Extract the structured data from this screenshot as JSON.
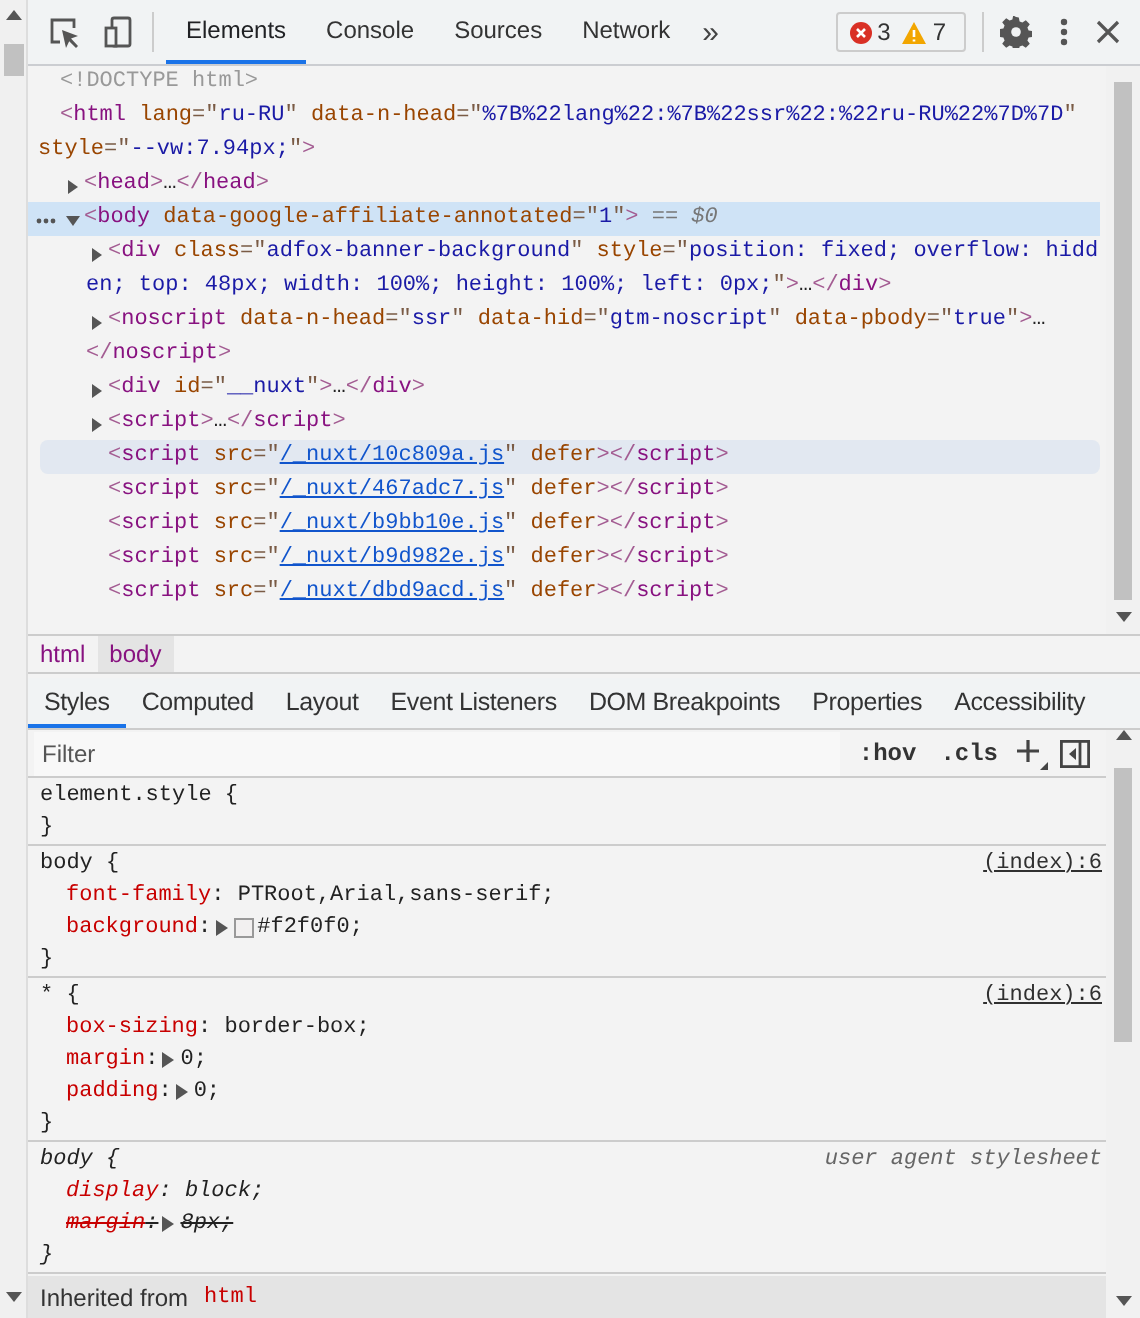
{
  "toolbar": {
    "tabs": [
      {
        "label": "Elements",
        "selected": true
      },
      {
        "label": "Console",
        "selected": false
      },
      {
        "label": "Sources",
        "selected": false
      },
      {
        "label": "Network",
        "selected": false
      }
    ],
    "more": "»",
    "issues": {
      "errors": "3",
      "warnings": "7"
    }
  },
  "dom_tree": [
    {
      "selected": false,
      "hovered": false,
      "lines": [
        [
          {
            "kind": "doctype",
            "text": "<!DOCTYPE html>"
          }
        ]
      ]
    },
    {
      "selected": false,
      "hovered": false,
      "lines": [
        [
          {
            "kind": "bracket",
            "text": "<"
          },
          {
            "kind": "tag",
            "text": "html"
          },
          {
            "kind": "attr",
            "text": " lang"
          },
          {
            "kind": "quote",
            "text": "=\""
          },
          {
            "kind": "value",
            "text": "ru-RU"
          },
          {
            "kind": "quote",
            "text": "\""
          },
          {
            "kind": "attr",
            "text": " data-n-head"
          },
          {
            "kind": "quote",
            "text": "=\""
          },
          {
            "kind": "value",
            "text": "%7B%22lang%22:%7B%22ssr%22:%22ru-RU%22%7D%7D"
          },
          {
            "kind": "quote",
            "text": "\""
          }
        ],
        [
          {
            "kind": "attr",
            "text": "style"
          },
          {
            "kind": "quote",
            "text": "=\""
          },
          {
            "kind": "value",
            "text": "--vw:7.94px;"
          },
          {
            "kind": "quote",
            "text": "\""
          },
          {
            "kind": "bracket",
            "text": ">"
          }
        ]
      ],
      "children": [
        {
          "selected": false,
          "hovered": false,
          "expanded": false,
          "lines": [
            [
              {
                "kind": "bracket",
                "text": "<"
              },
              {
                "kind": "tag",
                "text": "head"
              },
              {
                "kind": "bracket",
                "text": ">"
              },
              {
                "kind": "text",
                "text": "…"
              },
              {
                "kind": "bracket",
                "text": "</"
              },
              {
                "kind": "tag",
                "text": "head"
              },
              {
                "kind": "bracket",
                "text": ">"
              }
            ]
          ]
        },
        {
          "selected": true,
          "hovered": false,
          "expanded": true,
          "lines": [
            [
              {
                "kind": "bracket",
                "text": "<"
              },
              {
                "kind": "tag",
                "text": "body"
              },
              {
                "kind": "attr",
                "text": " data-google-affiliate-annotated"
              },
              {
                "kind": "quote",
                "text": "=\""
              },
              {
                "kind": "value",
                "text": "1"
              },
              {
                "kind": "quote",
                "text": "\""
              },
              {
                "kind": "bracket",
                "text": ">"
              },
              {
                "kind": "hint",
                "text": " == $0"
              }
            ]
          ],
          "children": [
            {
              "selected": false,
              "hovered": false,
              "expanded": false,
              "lines": [
                [
                  {
                    "kind": "bracket",
                    "text": "<"
                  },
                  {
                    "kind": "tag",
                    "text": "div"
                  },
                  {
                    "kind": "attr",
                    "text": " class"
                  },
                  {
                    "kind": "quote",
                    "text": "=\""
                  },
                  {
                    "kind": "value",
                    "text": "adfox-banner-background"
                  },
                  {
                    "kind": "quote",
                    "text": "\""
                  },
                  {
                    "kind": "attr",
                    "text": " style"
                  },
                  {
                    "kind": "quote",
                    "text": "=\""
                  },
                  {
                    "kind": "value",
                    "text": "position: fixed; overflow: hidd"
                  }
                ],
                [
                  {
                    "kind": "value",
                    "text": "en; top: 48px; width: 100%; height: 100%; left: 0px;"
                  },
                  {
                    "kind": "quote",
                    "text": "\""
                  },
                  {
                    "kind": "bracket",
                    "text": ">"
                  },
                  {
                    "kind": "text",
                    "text": "…"
                  },
                  {
                    "kind": "bracket",
                    "text": "</"
                  },
                  {
                    "kind": "tag",
                    "text": "div"
                  },
                  {
                    "kind": "bracket",
                    "text": ">"
                  }
                ]
              ]
            },
            {
              "selected": false,
              "hovered": false,
              "expanded": false,
              "lines": [
                [
                  {
                    "kind": "bracket",
                    "text": "<"
                  },
                  {
                    "kind": "tag",
                    "text": "noscript"
                  },
                  {
                    "kind": "attr",
                    "text": " data-n-head"
                  },
                  {
                    "kind": "quote",
                    "text": "=\""
                  },
                  {
                    "kind": "value",
                    "text": "ssr"
                  },
                  {
                    "kind": "quote",
                    "text": "\""
                  },
                  {
                    "kind": "attr",
                    "text": " data-hid"
                  },
                  {
                    "kind": "quote",
                    "text": "=\""
                  },
                  {
                    "kind": "value",
                    "text": "gtm-noscript"
                  },
                  {
                    "kind": "quote",
                    "text": "\""
                  },
                  {
                    "kind": "attr",
                    "text": " data-pbody"
                  },
                  {
                    "kind": "quote",
                    "text": "=\""
                  },
                  {
                    "kind": "value",
                    "text": "true"
                  },
                  {
                    "kind": "quote",
                    "text": "\""
                  },
                  {
                    "kind": "bracket",
                    "text": ">"
                  },
                  {
                    "kind": "text",
                    "text": "…"
                  }
                ],
                [
                  {
                    "kind": "bracket",
                    "text": "</"
                  },
                  {
                    "kind": "tag",
                    "text": "noscript"
                  },
                  {
                    "kind": "bracket",
                    "text": ">"
                  }
                ]
              ]
            },
            {
              "selected": false,
              "hovered": false,
              "expanded": false,
              "lines": [
                [
                  {
                    "kind": "bracket",
                    "text": "<"
                  },
                  {
                    "kind": "tag",
                    "text": "div"
                  },
                  {
                    "kind": "attr",
                    "text": " id"
                  },
                  {
                    "kind": "quote",
                    "text": "=\""
                  },
                  {
                    "kind": "value",
                    "text": "__nuxt"
                  },
                  {
                    "kind": "quote",
                    "text": "\""
                  },
                  {
                    "kind": "bracket",
                    "text": ">"
                  },
                  {
                    "kind": "text",
                    "text": "…"
                  },
                  {
                    "kind": "bracket",
                    "text": "</"
                  },
                  {
                    "kind": "tag",
                    "text": "div"
                  },
                  {
                    "kind": "bracket",
                    "text": ">"
                  }
                ]
              ]
            },
            {
              "selected": false,
              "hovered": false,
              "expanded": false,
              "lines": [
                [
                  {
                    "kind": "bracket",
                    "text": "<"
                  },
                  {
                    "kind": "tag",
                    "text": "script"
                  },
                  {
                    "kind": "bracket",
                    "text": ">"
                  },
                  {
                    "kind": "text",
                    "text": "…"
                  },
                  {
                    "kind": "bracket",
                    "text": "</"
                  },
                  {
                    "kind": "tag",
                    "text": "script"
                  },
                  {
                    "kind": "bracket",
                    "text": ">"
                  }
                ]
              ]
            },
            {
              "selected": false,
              "hovered": true,
              "lines": [
                [
                  {
                    "kind": "bracket",
                    "text": "<"
                  },
                  {
                    "kind": "tag",
                    "text": "script"
                  },
                  {
                    "kind": "attr",
                    "text": " src"
                  },
                  {
                    "kind": "quote",
                    "text": "=\""
                  },
                  {
                    "kind": "link",
                    "text": "/_nuxt/10c809a.js"
                  },
                  {
                    "kind": "quote",
                    "text": "\""
                  },
                  {
                    "kind": "attr",
                    "text": " defer"
                  },
                  {
                    "kind": "bracket",
                    "text": "></"
                  },
                  {
                    "kind": "tag",
                    "text": "script"
                  },
                  {
                    "kind": "bracket",
                    "text": ">"
                  }
                ]
              ]
            },
            {
              "selected": false,
              "hovered": false,
              "lines": [
                [
                  {
                    "kind": "bracket",
                    "text": "<"
                  },
                  {
                    "kind": "tag",
                    "text": "script"
                  },
                  {
                    "kind": "attr",
                    "text": " src"
                  },
                  {
                    "kind": "quote",
                    "text": "=\""
                  },
                  {
                    "kind": "link",
                    "text": "/_nuxt/467adc7.js"
                  },
                  {
                    "kind": "quote",
                    "text": "\""
                  },
                  {
                    "kind": "attr",
                    "text": " defer"
                  },
                  {
                    "kind": "bracket",
                    "text": "></"
                  },
                  {
                    "kind": "tag",
                    "text": "script"
                  },
                  {
                    "kind": "bracket",
                    "text": ">"
                  }
                ]
              ]
            },
            {
              "selected": false,
              "hovered": false,
              "lines": [
                [
                  {
                    "kind": "bracket",
                    "text": "<"
                  },
                  {
                    "kind": "tag",
                    "text": "script"
                  },
                  {
                    "kind": "attr",
                    "text": " src"
                  },
                  {
                    "kind": "quote",
                    "text": "=\""
                  },
                  {
                    "kind": "link",
                    "text": "/_nuxt/b9bb10e.js"
                  },
                  {
                    "kind": "quote",
                    "text": "\""
                  },
                  {
                    "kind": "attr",
                    "text": " defer"
                  },
                  {
                    "kind": "bracket",
                    "text": "></"
                  },
                  {
                    "kind": "tag",
                    "text": "script"
                  },
                  {
                    "kind": "bracket",
                    "text": ">"
                  }
                ]
              ]
            },
            {
              "selected": false,
              "hovered": false,
              "lines": [
                [
                  {
                    "kind": "bracket",
                    "text": "<"
                  },
                  {
                    "kind": "tag",
                    "text": "script"
                  },
                  {
                    "kind": "attr",
                    "text": " src"
                  },
                  {
                    "kind": "quote",
                    "text": "=\""
                  },
                  {
                    "kind": "link",
                    "text": "/_nuxt/b9d982e.js"
                  },
                  {
                    "kind": "quote",
                    "text": "\""
                  },
                  {
                    "kind": "attr",
                    "text": " defer"
                  },
                  {
                    "kind": "bracket",
                    "text": "></"
                  },
                  {
                    "kind": "tag",
                    "text": "script"
                  },
                  {
                    "kind": "bracket",
                    "text": ">"
                  }
                ]
              ]
            },
            {
              "selected": false,
              "hovered": false,
              "lines": [
                [
                  {
                    "kind": "bracket",
                    "text": "<"
                  },
                  {
                    "kind": "tag",
                    "text": "script"
                  },
                  {
                    "kind": "attr",
                    "text": " src"
                  },
                  {
                    "kind": "quote",
                    "text": "=\""
                  },
                  {
                    "kind": "link",
                    "text": "/_nuxt/dbd9acd.js"
                  },
                  {
                    "kind": "quote",
                    "text": "\""
                  },
                  {
                    "kind": "attr",
                    "text": " defer"
                  },
                  {
                    "kind": "bracket",
                    "text": "></"
                  },
                  {
                    "kind": "tag",
                    "text": "script"
                  },
                  {
                    "kind": "bracket",
                    "text": ">"
                  }
                ]
              ]
            }
          ]
        }
      ]
    }
  ],
  "breadcrumbs": [
    {
      "label": "html",
      "selected": false
    },
    {
      "label": "body",
      "selected": true
    }
  ],
  "sidebar_tabs": [
    {
      "label": "Styles",
      "selected": true
    },
    {
      "label": "Computed",
      "selected": false
    },
    {
      "label": "Layout",
      "selected": false
    },
    {
      "label": "Event Listeners",
      "selected": false
    },
    {
      "label": "DOM Breakpoints",
      "selected": false
    },
    {
      "label": "Properties",
      "selected": false
    },
    {
      "label": "Accessibility",
      "selected": false
    }
  ],
  "filter": {
    "placeholder": "Filter",
    "hov": ":hov",
    "cls": ".cls"
  },
  "rules": [
    {
      "italic": false,
      "header": "element.style {",
      "close": "}"
    },
    {
      "italic": false,
      "header": "body {",
      "source": "(index):6",
      "close": "}",
      "properties": [
        {
          "name": "font-family",
          "separator": ":",
          "value": "PTRoot,Arial,sans-serif;",
          "expandable": false,
          "overridden": false
        },
        {
          "name": "background",
          "separator": ":",
          "value": "#f2f0f0;",
          "color": "#f2f0f0",
          "expandable": true,
          "overridden": false
        }
      ]
    },
    {
      "italic": false,
      "header": "* {",
      "source": "(index):6",
      "close": "}",
      "properties": [
        {
          "name": "box-sizing",
          "separator": ":",
          "value": "border-box;",
          "expandable": false,
          "overridden": false
        },
        {
          "name": "margin",
          "separator": ":",
          "value": "0;",
          "expandable": true,
          "overridden": false
        },
        {
          "name": "padding",
          "separator": ":",
          "value": "0;",
          "expandable": true,
          "overridden": false
        }
      ]
    },
    {
      "italic": true,
      "header": "body {",
      "source": "user agent stylesheet",
      "close": "}",
      "properties": [
        {
          "name": "display",
          "separator": ":",
          "value": "block;",
          "expandable": false,
          "overridden": false
        },
        {
          "name": "margin",
          "separator": ":",
          "value": "8px;",
          "expandable": true,
          "overridden": true
        }
      ]
    }
  ],
  "inherited": {
    "label": "Inherited from",
    "selector": "html"
  }
}
